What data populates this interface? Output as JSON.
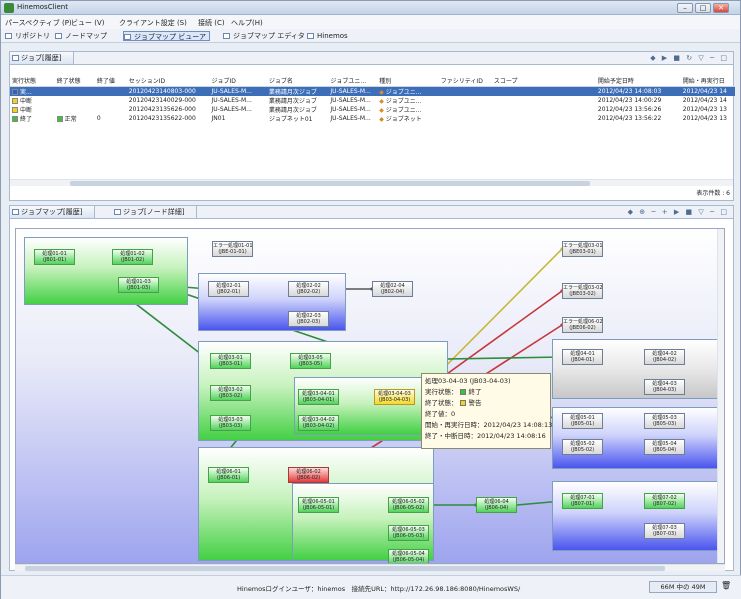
{
  "window": {
    "title": "HinemosClient"
  },
  "menu": [
    "パースペクティブ (P)",
    "ビュー (V)",
    "クライアント設定 (S)",
    "接続 (C)",
    "ヘルプ(H)"
  ],
  "perspectives": [
    "リポジトリ",
    "ノードマップ",
    "ジョブマップ ビューア",
    "ジョブマップ エディタ",
    "Hinemos"
  ],
  "top_view": {
    "tab": "ジョブ[履歴]",
    "columns": [
      "実行状態",
      "終了状態",
      "終了値",
      "セッションID",
      "ジョブID",
      "ジョブ名",
      "ジョブユニ...",
      "種別",
      "ファシリティID",
      "スコープ",
      "開始予定日時",
      "開始・再実行日"
    ],
    "rows": [
      {
        "status": "実...",
        "status_color": "#2c62c8",
        "end_status": "",
        "end_color": "",
        "end_value": "",
        "session": "20120423140803-000",
        "jobid": "JU-SALES-M...",
        "jobname": "業務請月次ジョブ",
        "unit": "JU-SALES-M...",
        "type": "ジョブユニ...",
        "facility": "",
        "scope": "",
        "scheduled": "2012/04/23 14:08:03",
        "start": "2012/04/23 14",
        "selected": true
      },
      {
        "status": "中断",
        "status_color": "#f2d21d",
        "end_status": "",
        "end_color": "",
        "end_value": "",
        "session": "20120423140029-000",
        "jobid": "JU-SALES-M...",
        "jobname": "業務請月次ジョブ",
        "unit": "JU-SALES-M...",
        "type": "ジョブユニ...",
        "facility": "",
        "scope": "",
        "scheduled": "2012/04/23 14:00:29",
        "start": "2012/04/23 14",
        "selected": false
      },
      {
        "status": "中断",
        "status_color": "#f2d21d",
        "end_status": "",
        "end_color": "",
        "end_value": "",
        "session": "20120423135626-000",
        "jobid": "JU-SALES-M...",
        "jobname": "業務請月次ジョブ",
        "unit": "JU-SALES-M...",
        "type": "ジョブユニ...",
        "facility": "",
        "scope": "",
        "scheduled": "2012/04/23 13:56:26",
        "start": "2012/04/23 13",
        "selected": false
      },
      {
        "status": "終了",
        "status_color": "#3bc43b",
        "end_status": "正常",
        "end_color": "#3bc43b",
        "end_value": "0",
        "session": "20120423135622-000",
        "jobid": "JN01",
        "jobname": "ジョブネット01",
        "unit": "JU-SALES-M...",
        "type": "ジョブネット",
        "facility": "",
        "scope": "",
        "scheduled": "2012/04/23 13:56:22",
        "start": "2012/04/23 13",
        "selected": false
      }
    ],
    "count_label": "表示件数 : 6"
  },
  "bottom_view": {
    "tabs": [
      "ジョブマップ[履歴]",
      "ジョブ[ノード詳細]"
    ],
    "nodes": [
      {
        "name": "処理01-01",
        "id": "(JB01-01)",
        "state": "g"
      },
      {
        "name": "処理01-02",
        "id": "(JB01-02)",
        "state": "g"
      },
      {
        "name": "処理01-03",
        "id": "(JB01-03)",
        "state": "g"
      },
      {
        "name": "エラー処理01-01",
        "id": "(JBE-01-01)",
        "state": "w"
      },
      {
        "name": "処理02-01",
        "id": "(JB02-01)",
        "state": "w"
      },
      {
        "name": "処理02-02",
        "id": "(JB02-02)",
        "state": "w"
      },
      {
        "name": "処理02-03",
        "id": "(JB02-03)",
        "state": "w"
      },
      {
        "name": "処理02-04",
        "id": "(JB02-04)",
        "state": "w"
      },
      {
        "name": "処理03-01",
        "id": "(JB03-01)",
        "state": "g"
      },
      {
        "name": "処理03-05",
        "id": "(JB03-05)",
        "state": "g"
      },
      {
        "name": "処理03-02",
        "id": "(JB03-02)",
        "state": "g"
      },
      {
        "name": "処理03-04-01",
        "id": "(JB03-04-01)",
        "state": "g"
      },
      {
        "name": "処理03-04-03",
        "id": "(JB03-04-03)",
        "state": "y"
      },
      {
        "name": "処理03-03",
        "id": "(JB03-03)",
        "state": "g"
      },
      {
        "name": "処理03-04-02",
        "id": "(JB03-04-02)",
        "state": "g"
      },
      {
        "name": "処理06-01",
        "id": "(JB06-01)",
        "state": "g"
      },
      {
        "name": "処理06-02",
        "id": "(JB06-02)",
        "state": "r"
      },
      {
        "name": "処理06-05-01",
        "id": "(JB06-05-01)",
        "state": "g"
      },
      {
        "name": "処理06-05-02",
        "id": "(JB06-05-02)",
        "state": "g"
      },
      {
        "name": "処理06-04",
        "id": "(JB06-04)",
        "state": "g"
      },
      {
        "name": "処理06-05-03",
        "id": "(JB06-05-03)",
        "state": "g"
      },
      {
        "name": "処理06-05-04",
        "id": "(JB06-05-04)",
        "state": "g"
      },
      {
        "name": "エラー処理03-01",
        "id": "(JBE03-01)",
        "state": "w"
      },
      {
        "name": "エラー処理03-02",
        "id": "(JBE03-02)",
        "state": "w"
      },
      {
        "name": "エラー処理06-02",
        "id": "(JBE06-02)",
        "state": "w"
      },
      {
        "name": "処理04-01",
        "id": "(JB04-01)",
        "state": "w"
      },
      {
        "name": "処理04-02",
        "id": "(JB04-02)",
        "state": "w"
      },
      {
        "name": "処理04-03",
        "id": "(JB04-03)",
        "state": "w"
      },
      {
        "name": "処理05-01",
        "id": "(JB05-01)",
        "state": "w"
      },
      {
        "name": "処理05-03",
        "id": "(JB05-03)",
        "state": "w"
      },
      {
        "name": "処理05-02",
        "id": "(JB05-02)",
        "state": "w"
      },
      {
        "name": "処理05-04",
        "id": "(JB05-04)",
        "state": "w"
      },
      {
        "name": "処理07-01",
        "id": "(JB07-01)",
        "state": "g"
      },
      {
        "name": "処理07-02",
        "id": "(JB07-02)",
        "state": "g"
      },
      {
        "name": "処理07-03",
        "id": "(JB07-03)",
        "state": "w"
      }
    ],
    "tooltip": {
      "title": "処理03-04-03 (JB03-04-03)",
      "run_label": "実行状態：",
      "run_value": "終了",
      "run_color": "#3bc43b",
      "end_label": "終了状態：",
      "end_value": "警告",
      "end_color": "#f2d21d",
      "endval_label": "終了値：",
      "endval_value": "0",
      "start_label": "開始・再実行日時：",
      "start_value": "2012/04/23 14:08:13",
      "finish_label": "終了・中断日時：",
      "finish_value": "2012/04/23 14:08:16"
    }
  },
  "status": {
    "text": "Hinemosログインユーザ：hinemos　接続先URL：http://172.26.98.186:8080/HinemosWS/",
    "memory": "66M 中の 49M"
  }
}
